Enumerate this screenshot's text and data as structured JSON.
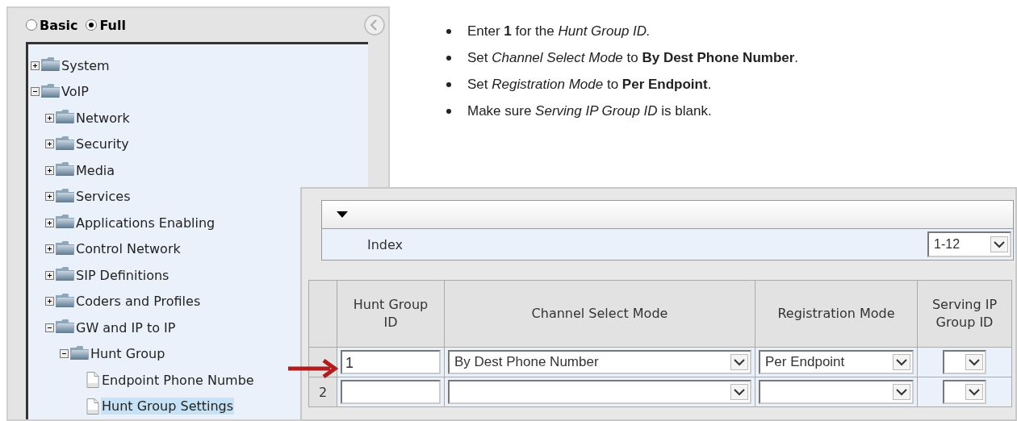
{
  "mode_options": [
    {
      "label": "Basic",
      "selected": false
    },
    {
      "label": "Full",
      "selected": true
    }
  ],
  "tree": [
    {
      "label": "System",
      "kind": "folder",
      "expanded": false,
      "selected": false
    },
    {
      "label": "VoIP",
      "kind": "folder",
      "expanded": true,
      "selected": false,
      "children": [
        {
          "label": "Network",
          "kind": "folder",
          "expanded": false,
          "selected": false
        },
        {
          "label": "Security",
          "kind": "folder",
          "expanded": false,
          "selected": false
        },
        {
          "label": "Media",
          "kind": "folder",
          "expanded": false,
          "selected": false
        },
        {
          "label": "Services",
          "kind": "folder",
          "expanded": false,
          "selected": false
        },
        {
          "label": "Applications Enabling",
          "kind": "folder",
          "expanded": false,
          "selected": false
        },
        {
          "label": "Control Network",
          "kind": "folder",
          "expanded": false,
          "selected": false
        },
        {
          "label": "SIP Definitions",
          "kind": "folder",
          "expanded": false,
          "selected": false
        },
        {
          "label": "Coders and Profiles",
          "kind": "folder",
          "expanded": false,
          "selected": false
        },
        {
          "label": "GW and IP to IP",
          "kind": "folder",
          "expanded": true,
          "selected": false,
          "children": [
            {
              "label": "Hunt Group",
              "kind": "folder",
              "expanded": true,
              "selected": false,
              "children": [
                {
                  "label": "Endpoint Phone Numbe",
                  "kind": "page",
                  "selected": false
                },
                {
                  "label": "Hunt Group Settings",
                  "kind": "page",
                  "selected": true
                }
              ]
            }
          ]
        }
      ]
    }
  ],
  "instructions": [
    "Enter **1** for the *Hunt Group ID.*",
    "Set *Channel Select Mode* to **By Dest Phone Number**.",
    "Set *Registration Mode* to **Per Endpoint**.",
    "Make sure *Serving IP Group ID* is blank."
  ],
  "table_panel": {
    "index_label": "Index",
    "index_range": "1-12",
    "columns": [
      "Hunt Group ID",
      "Channel Select Mode",
      "Registration Mode",
      "Serving IP Group ID"
    ],
    "rows": [
      {
        "hunt_group_id": "1",
        "channel_select_mode": "By Dest Phone Number",
        "registration_mode": "Per Endpoint"
      },
      {
        "index": "2"
      }
    ]
  }
}
